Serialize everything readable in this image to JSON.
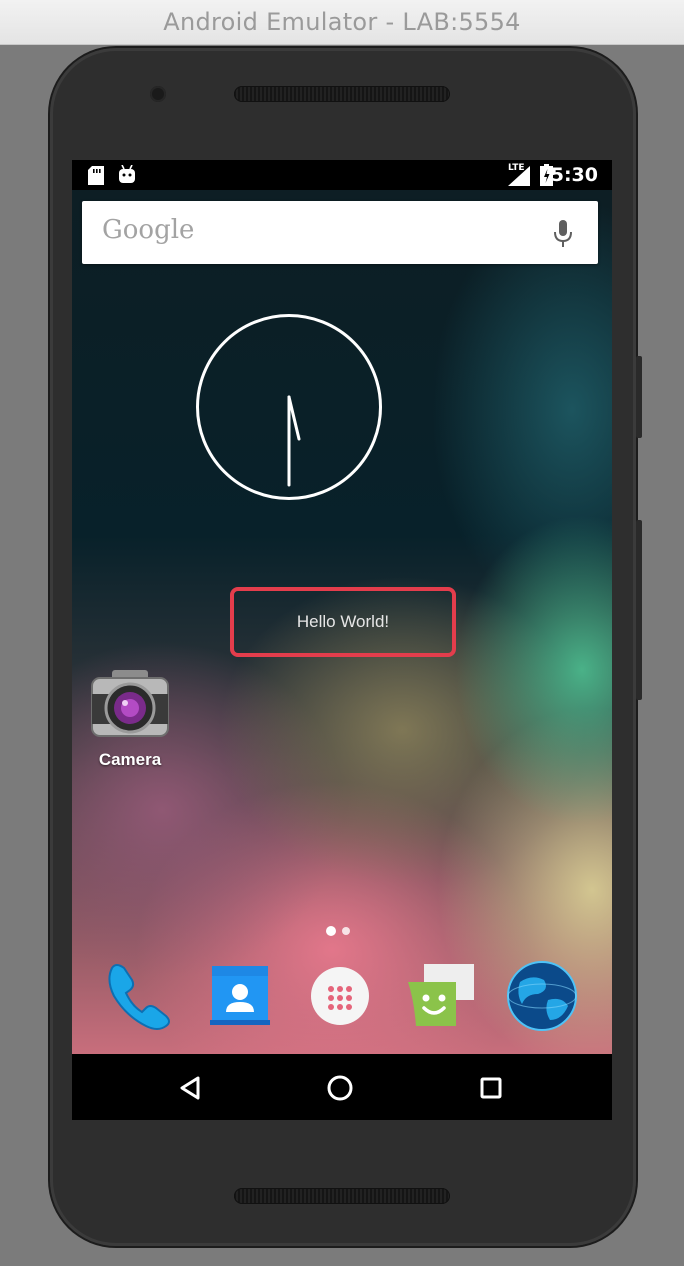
{
  "window": {
    "title": "Android Emulator - LAB:5554"
  },
  "status_bar": {
    "network": "LTE",
    "time": "5:30"
  },
  "search_widget": {
    "logo": "Google",
    "mic_icon": "mic-icon"
  },
  "clock_widget": {
    "hour_hand": "5",
    "minute_hand": "30"
  },
  "hello": {
    "text": "Hello World!",
    "highlight_color": "#e43d4c"
  },
  "home_apps": [
    {
      "label": "Camera",
      "icon": "camera-icon"
    }
  ],
  "page_indicator": {
    "pages": 2,
    "current": 1
  },
  "dock": [
    {
      "name": "phone",
      "icon": "phone-icon"
    },
    {
      "name": "contacts",
      "icon": "contacts-icon"
    },
    {
      "name": "app-drawer",
      "icon": "all-apps-icon"
    },
    {
      "name": "messaging",
      "icon": "messaging-icon"
    },
    {
      "name": "browser",
      "icon": "globe-icon"
    }
  ],
  "nav_bar": {
    "back": "back-icon",
    "home": "home-icon",
    "recents": "recents-icon"
  }
}
